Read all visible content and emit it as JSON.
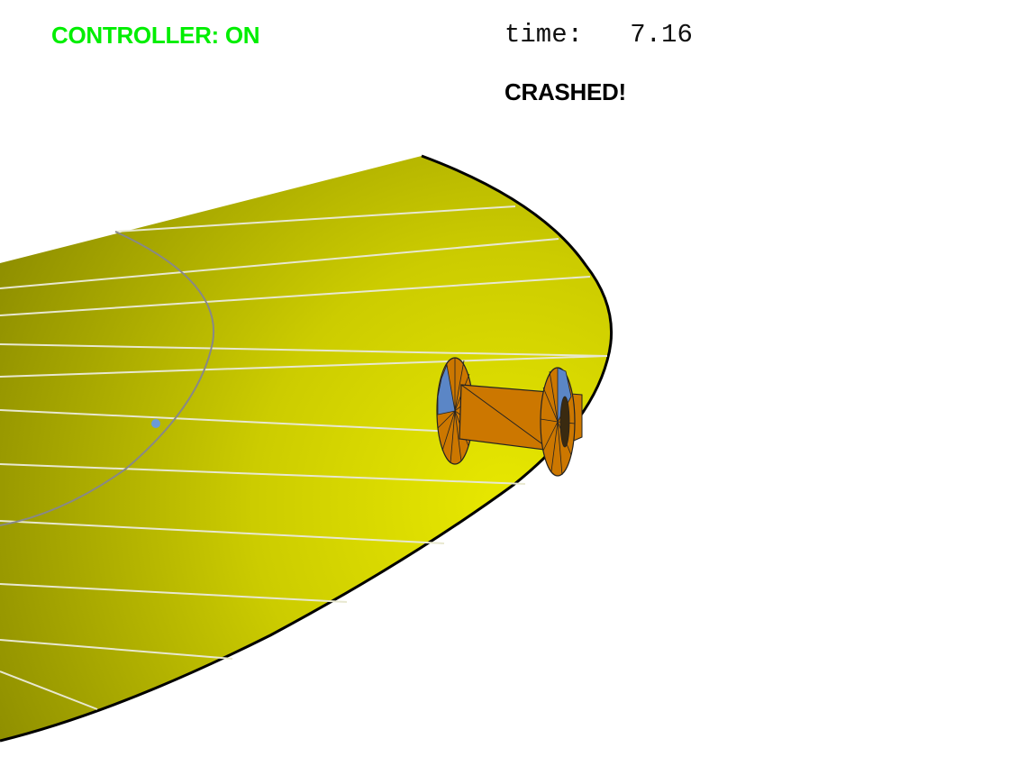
{
  "hud": {
    "controller_status": "CONTROLLER: ON",
    "time_label": "time:",
    "time_value": "7.16",
    "crash_status": "CRASHED!"
  },
  "colors": {
    "controller_on": "#00ee00",
    "track_light": "#e6e600",
    "track_dark": "#9a9a00",
    "car_body": "#cc7700",
    "wheel_accent": "#5b86c6",
    "path_line": "#888888"
  }
}
